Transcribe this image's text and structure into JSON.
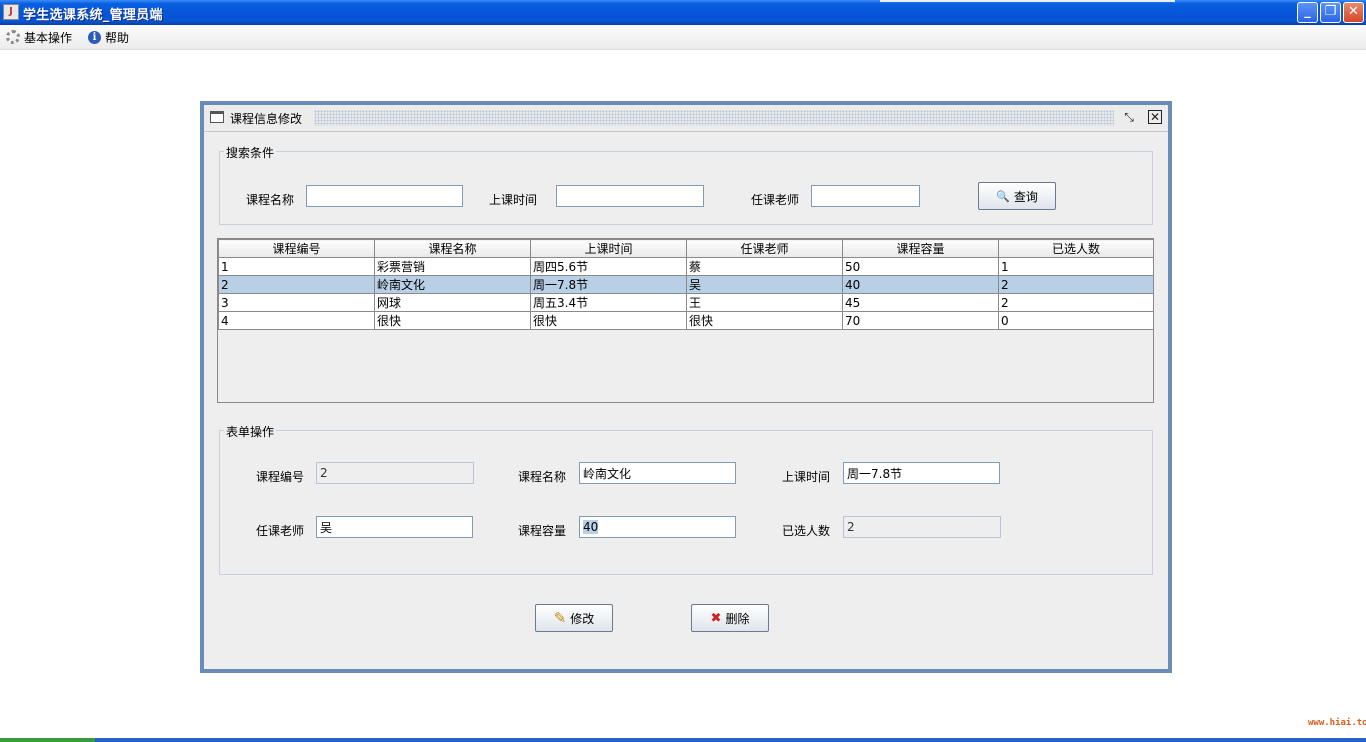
{
  "window": {
    "title": "学生选课系统_管理员端",
    "minimize": "_",
    "maximize": "❐",
    "close": "✕"
  },
  "menu": {
    "items": [
      {
        "label": "基本操作",
        "icon": "gear-icon"
      },
      {
        "label": "帮助",
        "icon": "info-icon"
      }
    ]
  },
  "frame": {
    "title": "课程信息修改",
    "restore": "⤡",
    "close": "✕"
  },
  "search": {
    "legend": "搜索条件",
    "course_name_label": "课程名称",
    "course_name_value": "",
    "time_label": "上课时间",
    "time_value": "",
    "teacher_label": "任课老师",
    "teacher_value": "",
    "query_button": "查询",
    "query_icon": "🔍"
  },
  "table": {
    "columns": [
      "课程编号",
      "课程名称",
      "上课时间",
      "任课老师",
      "课程容量",
      "已选人数"
    ],
    "rows": [
      [
        "1",
        "彩票营销",
        "周四5.6节",
        "蔡",
        "50",
        "1"
      ],
      [
        "2",
        "岭南文化",
        "周一7.8节",
        "吴",
        "40",
        "2"
      ],
      [
        "3",
        "网球",
        "周五3.4节",
        "王",
        "45",
        "2"
      ],
      [
        "4",
        "很快",
        "很快",
        "很快",
        "70",
        "0"
      ]
    ],
    "selected_row": 1
  },
  "form": {
    "legend": "表单操作",
    "id_label": "课程编号",
    "id_value": "2",
    "name_label": "课程名称",
    "name_value": "岭南文化",
    "time_label": "上课时间",
    "time_value": "周一7.8节",
    "teacher_label": "任课老师",
    "teacher_value": "吴",
    "capacity_label": "课程容量",
    "capacity_value": "40",
    "enrolled_label": "已选人数",
    "enrolled_value": "2"
  },
  "actions": {
    "modify_label": "修改",
    "modify_icon": "✎",
    "delete_label": "删除",
    "delete_icon": "✖"
  },
  "watermark": "www.hiai.top"
}
